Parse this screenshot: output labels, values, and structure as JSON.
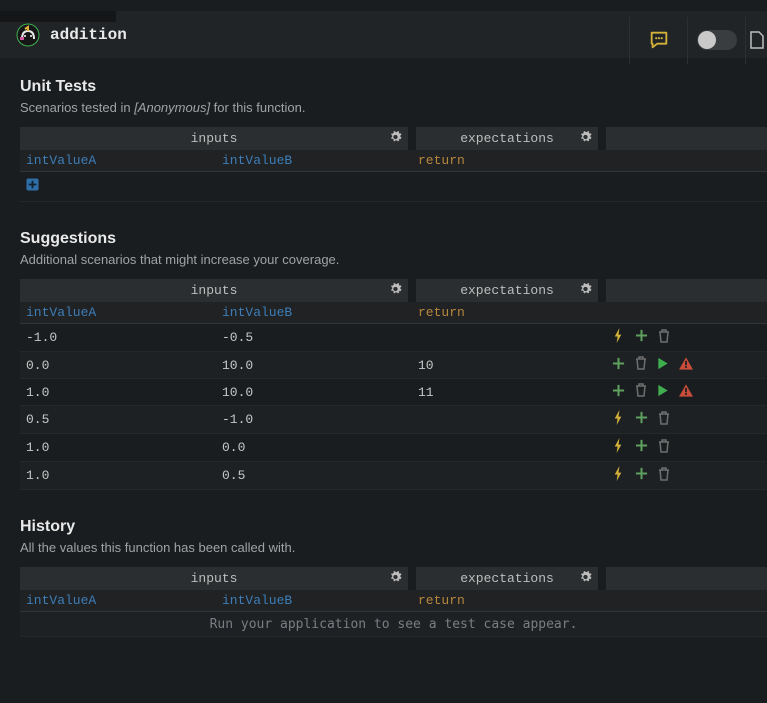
{
  "header": {
    "function_name": "addition"
  },
  "sections": {
    "unit_tests": {
      "title": "Unit Tests",
      "subtitle_pre": "Scenarios tested in ",
      "subtitle_em": "[Anonymous]",
      "subtitle_post": " for this function.",
      "headers": {
        "inputs": "inputs",
        "expectations": "expectations"
      },
      "columns": {
        "a": "intValueA",
        "b": "intValueB",
        "ret": "return"
      },
      "rows": []
    },
    "suggestions": {
      "title": "Suggestions",
      "subtitle": "Additional scenarios that might increase your coverage.",
      "headers": {
        "inputs": "inputs",
        "expectations": "expectations"
      },
      "columns": {
        "a": "intValueA",
        "b": "intValueB",
        "ret": "return"
      },
      "rows": [
        {
          "a": "-1.0",
          "b": "-0.5",
          "ret": "",
          "actions": [
            "bolt",
            "add",
            "trash"
          ]
        },
        {
          "a": "0.0",
          "b": "10.0",
          "ret": "10",
          "actions": [
            "add",
            "trash",
            "play",
            "warn"
          ]
        },
        {
          "a": "1.0",
          "b": "10.0",
          "ret": "11",
          "actions": [
            "add",
            "trash",
            "play",
            "warn"
          ]
        },
        {
          "a": "0.5",
          "b": "-1.0",
          "ret": "",
          "actions": [
            "bolt",
            "add",
            "trash"
          ]
        },
        {
          "a": "1.0",
          "b": "0.0",
          "ret": "",
          "actions": [
            "bolt",
            "add",
            "trash"
          ]
        },
        {
          "a": "1.0",
          "b": "0.5",
          "ret": "",
          "actions": [
            "bolt",
            "add",
            "trash"
          ]
        }
      ]
    },
    "history": {
      "title": "History",
      "subtitle": "All the values this function has been called with.",
      "headers": {
        "inputs": "inputs",
        "expectations": "expectations"
      },
      "columns": {
        "a": "intValueA",
        "b": "intValueB",
        "ret": "return"
      },
      "empty_message": "Run your application to see a test case appear."
    }
  },
  "icons": {
    "gear": "gear-icon",
    "comment": "comment-icon",
    "plus": "plus-square-icon",
    "bolt": "bolt-icon",
    "add": "add-icon",
    "trash": "trash-icon",
    "play": "play-icon",
    "warn": "warn-icon"
  },
  "colors": {
    "bolt": "#d4b23a",
    "add": "#5ea05e",
    "trash": "#6e6e6e",
    "play": "#3fae4f",
    "warn": "#c84d3a",
    "comment": "#d4b23a",
    "link": "#3d7eb8",
    "ret": "#b8863d"
  }
}
